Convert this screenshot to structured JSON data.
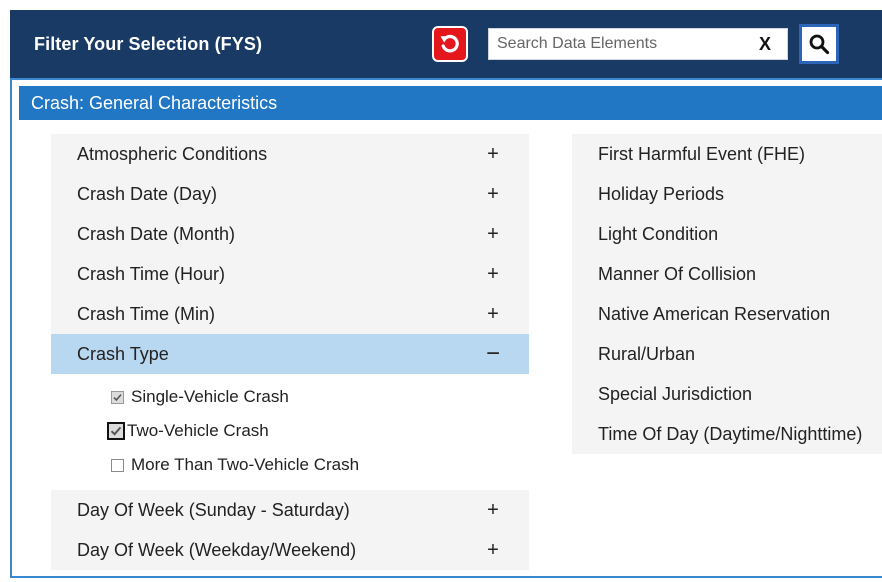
{
  "header": {
    "title": "Filter Your Selection (FYS)",
    "search": {
      "placeholder": "Search Data Elements",
      "value": "",
      "clear_label": "X"
    }
  },
  "section": {
    "title": "Crash: General Characteristics"
  },
  "left_items": [
    {
      "label": "Atmospheric Conditions",
      "expander": "+"
    },
    {
      "label": "Crash Date (Day)",
      "expander": "+"
    },
    {
      "label": "Crash Date (Month)",
      "expander": "+"
    },
    {
      "label": "Crash Time (Hour)",
      "expander": "+"
    },
    {
      "label": "Crash Time (Min)",
      "expander": "+"
    },
    {
      "label": "Crash Type",
      "expander": "−"
    },
    {
      "label": "Day Of Week (Sunday - Saturday)",
      "expander": "+"
    },
    {
      "label": "Day Of Week (Weekday/Weekend)",
      "expander": "+"
    }
  ],
  "crash_type_options": [
    {
      "label": "Single-Vehicle Crash",
      "checked": true
    },
    {
      "label": "Two-Vehicle Crash",
      "checked": true
    },
    {
      "label": "More Than Two-Vehicle Crash",
      "checked": false
    }
  ],
  "right_items": [
    {
      "label": "First Harmful Event (FHE)"
    },
    {
      "label": "Holiday Periods"
    },
    {
      "label": "Light Condition"
    },
    {
      "label": "Manner Of Collision"
    },
    {
      "label": "Native American Reservation"
    },
    {
      "label": "Rural/Urban"
    },
    {
      "label": "Special Jurisdiction"
    },
    {
      "label": "Time Of Day (Daytime/Nighttime)"
    }
  ],
  "colors": {
    "header_bg": "#1a3a66",
    "section_bg": "#2277c5",
    "active_row": "#b8d7f0",
    "reset_red": "#e4171d"
  },
  "icons": {
    "reset": "undo-arrow-icon",
    "search": "magnifier-icon"
  }
}
